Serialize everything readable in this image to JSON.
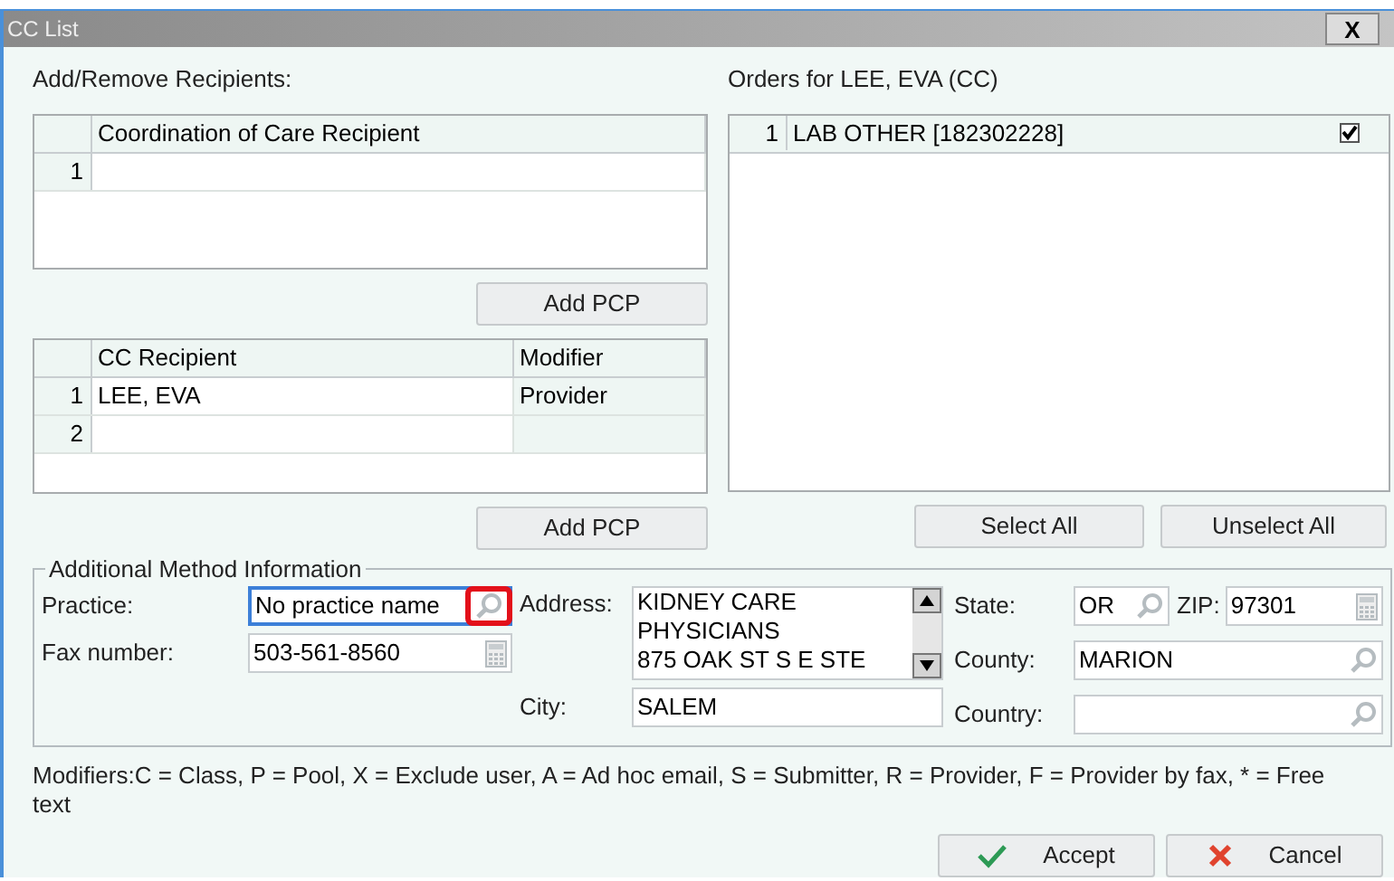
{
  "window": {
    "title": "CC List",
    "close": "X"
  },
  "recipients_label": "Add/Remove Recipients:",
  "coc_table": {
    "columns": [
      "Coordination of Care Recipient"
    ],
    "rows": [
      {
        "num": "1",
        "cells": [
          ""
        ]
      }
    ]
  },
  "add_pcp_1": "Add PCP",
  "cc_table": {
    "columns": [
      "CC Recipient",
      "Modifier"
    ],
    "rows": [
      {
        "num": "1",
        "cells": [
          "LEE, EVA",
          "Provider"
        ]
      },
      {
        "num": "2",
        "cells": [
          "",
          ""
        ]
      }
    ]
  },
  "add_pcp_2": "Add PCP",
  "orders_label": "Orders for LEE, EVA (CC)",
  "orders": [
    {
      "num": "1",
      "name": "LAB OTHER [182302228]",
      "checked": true
    }
  ],
  "select_all": "Select All",
  "unselect_all": "Unselect All",
  "method": {
    "title": "Additional Method Information",
    "practice": {
      "label": "Practice:",
      "value": "No practice name",
      "focused": true,
      "lookup_highlighted": true
    },
    "fax": {
      "label": "Fax number:",
      "value": "503-561-8560"
    },
    "address": {
      "label": "Address:",
      "lines": [
        "KIDNEY CARE",
        "PHYSICIANS",
        "875 OAK ST S E STE"
      ]
    },
    "city": {
      "label": "City:",
      "value": "SALEM"
    },
    "state": {
      "label": "State:",
      "value": "OR"
    },
    "zip": {
      "label": "ZIP:",
      "value": "97301"
    },
    "county": {
      "label": "County:",
      "value": "MARION"
    },
    "country": {
      "label": "Country:"
    }
  },
  "modifiers_note": "Modifiers:C = Class, P = Pool, X = Exclude user, A = Ad hoc email, S = Submitter, R = Provider, F = Provider by fax, * = Free text",
  "buttons": [
    {
      "kind": "accept",
      "label": "Accept"
    },
    {
      "kind": "cancel",
      "label": "Cancel"
    }
  ]
}
